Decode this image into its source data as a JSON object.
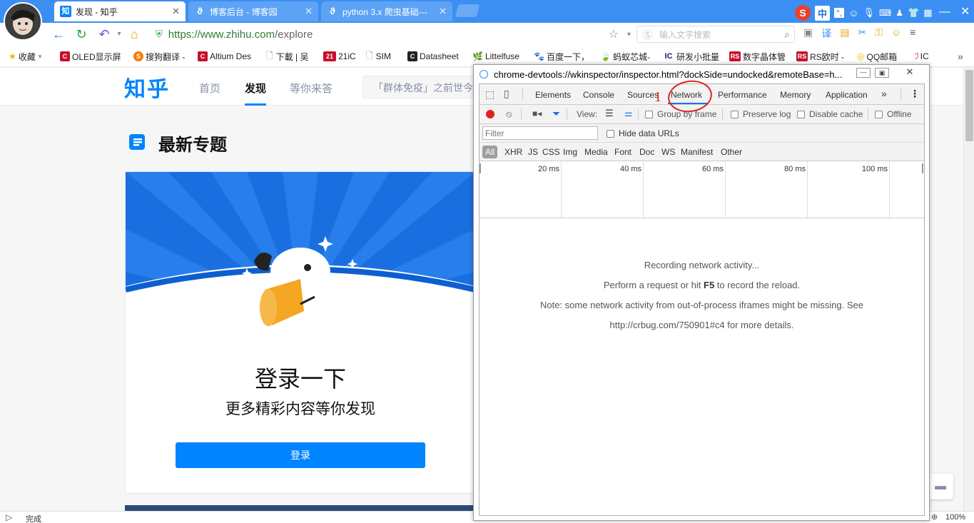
{
  "browser": {
    "tabs": [
      {
        "title": "发现 - 知乎",
        "favicon": "知"
      },
      {
        "title": "博客后台 - 博客园"
      },
      {
        "title": "python 3.x 爬虫基础---"
      }
    ],
    "url_prefix": "https://www.zhihu.com",
    "url_path": "/explore",
    "search_placeholder": "输入文字搜索",
    "ime_label": "中",
    "bookmarks": [
      {
        "label": "收藏"
      },
      {
        "label": "OLED显示屏"
      },
      {
        "label": "搜狗翻译 -"
      },
      {
        "label": "Altium Des"
      },
      {
        "label": "下載 | 吴"
      },
      {
        "label": "21iC"
      },
      {
        "label": "SIM"
      },
      {
        "label": "Datasheet"
      },
      {
        "label": "Littelfuse"
      },
      {
        "label": "百度一下，"
      },
      {
        "label": "蚂蚁芯城-"
      },
      {
        "label": "研发小批量"
      },
      {
        "label": "数字晶体管"
      },
      {
        "label": "RS欧时 -"
      },
      {
        "label": "QQ邮箱"
      },
      {
        "label": "IC"
      }
    ],
    "status_text": "完成",
    "zoom": "100%"
  },
  "zhihu": {
    "logo": "知乎",
    "nav": [
      "首页",
      "发现",
      "等你来答"
    ],
    "search_text": "「群体免疫」之前世今生",
    "section_title": "最新专题",
    "login_title": "登录一下",
    "login_subtitle": "更多精彩内容等你发现",
    "login_button": "登录"
  },
  "devtools": {
    "title": "chrome-devtools://wkinspector/inspector.html?dockSide=undocked&remoteBase=h...",
    "tabs": [
      "Elements",
      "Console",
      "Sources",
      "Network",
      "Performance",
      "Memory",
      "Application"
    ],
    "more": "»",
    "annotation": "1",
    "toolbar": {
      "view_label": "View:",
      "group_by_frame": "Group by frame",
      "preserve_log": "Preserve log",
      "disable_cache": "Disable cache",
      "offline": "Offline"
    },
    "filter_placeholder": "Filter",
    "hide_data_urls": "Hide data URLs",
    "types": [
      "All",
      "XHR",
      "JS",
      "CSS",
      "Img",
      "Media",
      "Font",
      "Doc",
      "WS",
      "Manifest",
      "Other"
    ],
    "ticks": [
      "20 ms",
      "40 ms",
      "60 ms",
      "80 ms",
      "100 ms"
    ],
    "msg1": "Recording network activity...",
    "msg2_a": "Perform a request or hit ",
    "msg2_key": "F5",
    "msg2_b": " to record the reload.",
    "msg3": "Note: some network activity from out-of-process iframes might be missing. See",
    "msg4": "http://crbug.com/750901#c4 for more details."
  },
  "colors": {
    "tabstrip": "#3b8ff2",
    "zhihu_blue": "#0084ff",
    "annotation_red": "#d9261c",
    "record_red": "#e0241b"
  }
}
